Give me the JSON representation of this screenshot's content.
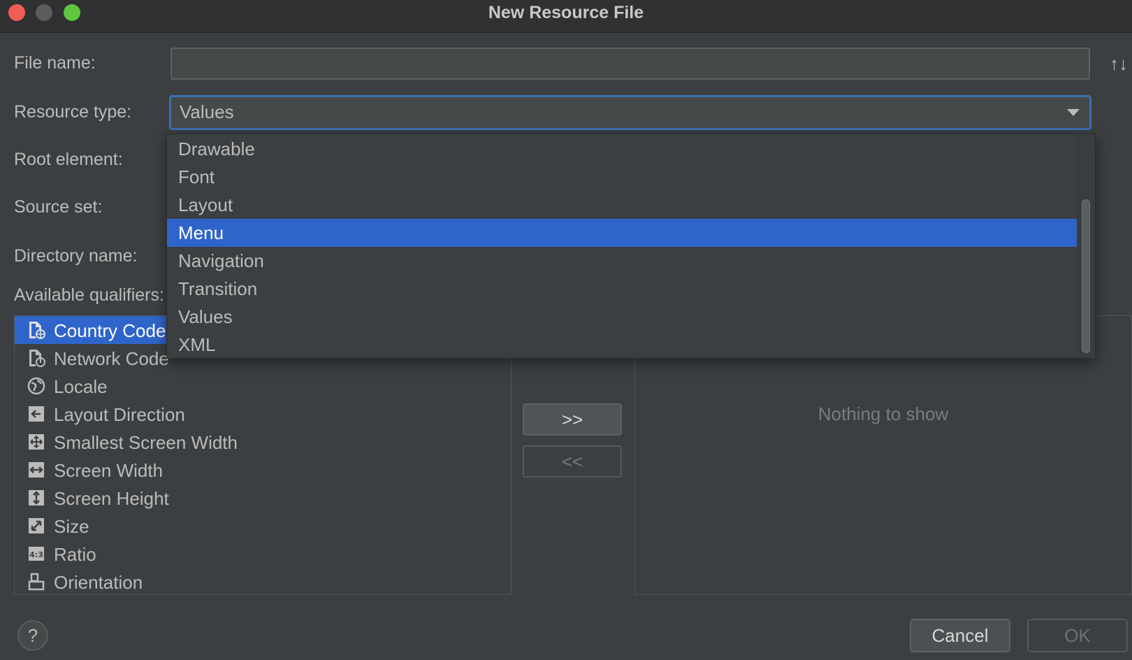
{
  "window": {
    "title": "New Resource File"
  },
  "labels": {
    "file_name": "File name:",
    "resource_type": "Resource type:",
    "root_element": "Root element:",
    "source_set": "Source set:",
    "directory_name": "Directory name:",
    "available_qualifiers": "Available qualifiers:"
  },
  "file_name": {
    "value": "",
    "sort_icon": "↑↓"
  },
  "resource_type": {
    "selected": "Values"
  },
  "dropdown": {
    "items": [
      "Drawable",
      "Font",
      "Layout",
      "Menu",
      "Navigation",
      "Transition",
      "Values",
      "XML"
    ],
    "highlighted": "Menu"
  },
  "qualifiers": {
    "items": [
      {
        "label": "Country Code",
        "icon": "country-code-icon",
        "selected": true
      },
      {
        "label": "Network Code",
        "icon": "network-code-icon",
        "selected": false
      },
      {
        "label": "Locale",
        "icon": "globe-icon",
        "selected": false
      },
      {
        "label": "Layout Direction",
        "icon": "layout-direction-icon",
        "selected": false
      },
      {
        "label": "Smallest Screen Width",
        "icon": "smallest-screen-width-icon",
        "selected": false
      },
      {
        "label": "Screen Width",
        "icon": "screen-width-icon",
        "selected": false
      },
      {
        "label": "Screen Height",
        "icon": "screen-height-icon",
        "selected": false
      },
      {
        "label": "Size",
        "icon": "size-icon",
        "selected": false
      },
      {
        "label": "Ratio",
        "icon": "ratio-icon",
        "selected": false
      },
      {
        "label": "Orientation",
        "icon": "orientation-icon",
        "selected": false
      }
    ]
  },
  "buttons": {
    "add": ">>",
    "remove": "<<",
    "help": "?",
    "cancel": "Cancel",
    "ok": "OK"
  },
  "chosen": {
    "empty_text": "Nothing to show"
  },
  "colors": {
    "background": "#3c3f41",
    "accent": "#2f65ca",
    "focus": "#3d6fae"
  }
}
